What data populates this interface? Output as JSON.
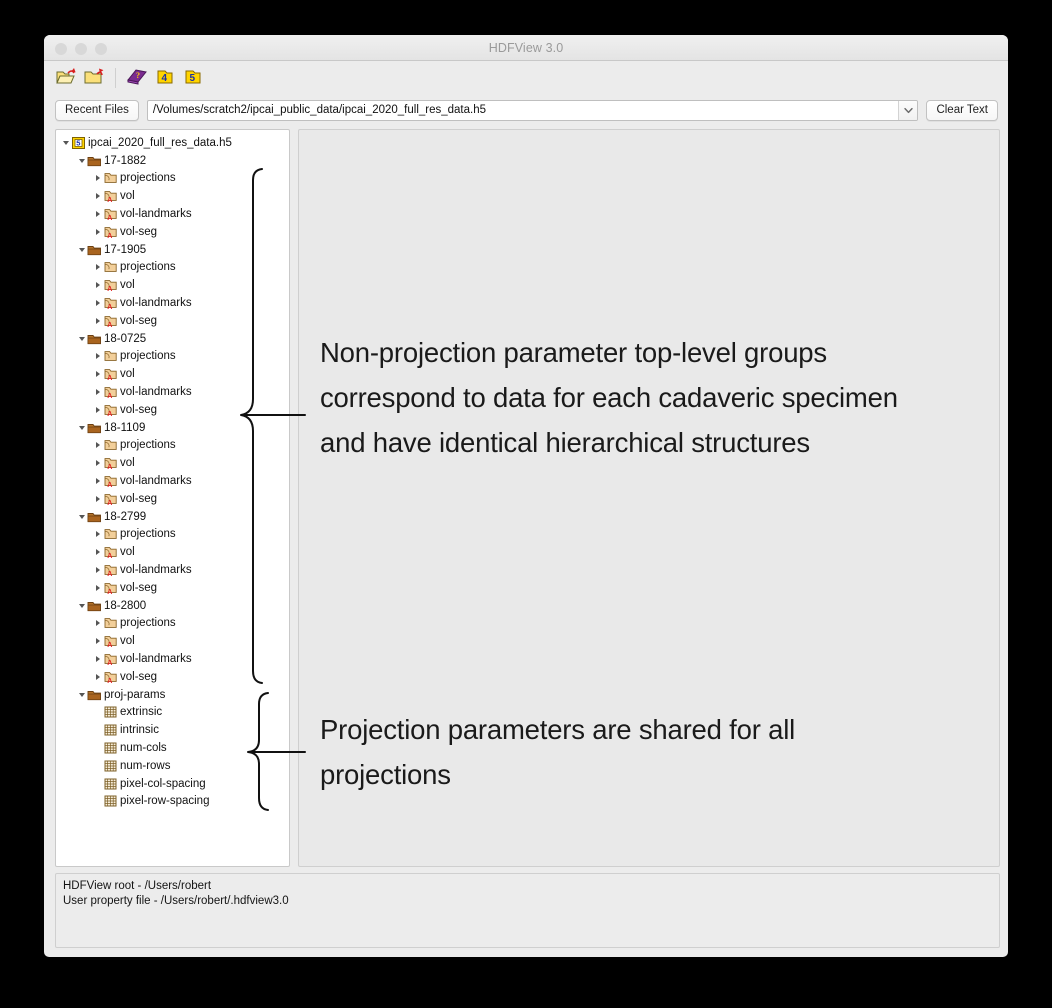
{
  "window": {
    "title": "HDFView 3.0",
    "traffic_lights": [
      "close",
      "minimize",
      "maximize"
    ]
  },
  "toolbar": {
    "buttons": [
      {
        "name": "open-file-icon",
        "tooltip": "Open"
      },
      {
        "name": "close-file-icon",
        "tooltip": "Close"
      },
      {
        "name": "help-book-icon",
        "tooltip": "Help"
      },
      {
        "name": "hdf4-icon",
        "tooltip": "HDF4 Library Version",
        "label": "4"
      },
      {
        "name": "hdf5-icon",
        "tooltip": "HDF5 Library Version",
        "label": "5"
      }
    ]
  },
  "pathbar": {
    "recent_files_label": "Recent Files",
    "path_value": "/Volumes/scratch2/ipcai_public_data/ipcai_2020_full_res_data.h5",
    "clear_text_label": "Clear Text"
  },
  "tree": {
    "rows": [
      {
        "depth": 0,
        "state": "open",
        "icon": "h5-file-icon",
        "label": "ipcai_2020_full_res_data.h5"
      },
      {
        "depth": 1,
        "state": "open",
        "icon": "group-icon",
        "label": "17-1882"
      },
      {
        "depth": 2,
        "state": "collapsed",
        "icon": "subgroup-icon",
        "label": "projections"
      },
      {
        "depth": 2,
        "state": "collapsed",
        "icon": "attr-group-icon",
        "label": "vol"
      },
      {
        "depth": 2,
        "state": "collapsed",
        "icon": "attr-group-icon",
        "label": "vol-landmarks"
      },
      {
        "depth": 2,
        "state": "collapsed",
        "icon": "attr-group-icon",
        "label": "vol-seg"
      },
      {
        "depth": 1,
        "state": "open",
        "icon": "group-icon",
        "label": "17-1905"
      },
      {
        "depth": 2,
        "state": "collapsed",
        "icon": "subgroup-icon",
        "label": "projections"
      },
      {
        "depth": 2,
        "state": "collapsed",
        "icon": "attr-group-icon",
        "label": "vol"
      },
      {
        "depth": 2,
        "state": "collapsed",
        "icon": "attr-group-icon",
        "label": "vol-landmarks"
      },
      {
        "depth": 2,
        "state": "collapsed",
        "icon": "attr-group-icon",
        "label": "vol-seg"
      },
      {
        "depth": 1,
        "state": "open",
        "icon": "group-icon",
        "label": "18-0725"
      },
      {
        "depth": 2,
        "state": "collapsed",
        "icon": "subgroup-icon",
        "label": "projections"
      },
      {
        "depth": 2,
        "state": "collapsed",
        "icon": "attr-group-icon",
        "label": "vol"
      },
      {
        "depth": 2,
        "state": "collapsed",
        "icon": "attr-group-icon",
        "label": "vol-landmarks"
      },
      {
        "depth": 2,
        "state": "collapsed",
        "icon": "attr-group-icon",
        "label": "vol-seg"
      },
      {
        "depth": 1,
        "state": "open",
        "icon": "group-icon",
        "label": "18-1109"
      },
      {
        "depth": 2,
        "state": "collapsed",
        "icon": "subgroup-icon",
        "label": "projections"
      },
      {
        "depth": 2,
        "state": "collapsed",
        "icon": "attr-group-icon",
        "label": "vol"
      },
      {
        "depth": 2,
        "state": "collapsed",
        "icon": "attr-group-icon",
        "label": "vol-landmarks"
      },
      {
        "depth": 2,
        "state": "collapsed",
        "icon": "attr-group-icon",
        "label": "vol-seg"
      },
      {
        "depth": 1,
        "state": "open",
        "icon": "group-icon",
        "label": "18-2799"
      },
      {
        "depth": 2,
        "state": "collapsed",
        "icon": "subgroup-icon",
        "label": "projections"
      },
      {
        "depth": 2,
        "state": "collapsed",
        "icon": "attr-group-icon",
        "label": "vol"
      },
      {
        "depth": 2,
        "state": "collapsed",
        "icon": "attr-group-icon",
        "label": "vol-landmarks"
      },
      {
        "depth": 2,
        "state": "collapsed",
        "icon": "attr-group-icon",
        "label": "vol-seg"
      },
      {
        "depth": 1,
        "state": "open",
        "icon": "group-icon",
        "label": "18-2800"
      },
      {
        "depth": 2,
        "state": "collapsed",
        "icon": "subgroup-icon",
        "label": "projections"
      },
      {
        "depth": 2,
        "state": "collapsed",
        "icon": "attr-group-icon",
        "label": "vol"
      },
      {
        "depth": 2,
        "state": "collapsed",
        "icon": "attr-group-icon",
        "label": "vol-landmarks"
      },
      {
        "depth": 2,
        "state": "collapsed",
        "icon": "attr-group-icon",
        "label": "vol-seg"
      },
      {
        "depth": 1,
        "state": "open",
        "icon": "group-icon",
        "label": "proj-params"
      },
      {
        "depth": 2,
        "state": "leaf",
        "icon": "dataset-icon",
        "label": "extrinsic"
      },
      {
        "depth": 2,
        "state": "leaf",
        "icon": "dataset-icon",
        "label": "intrinsic"
      },
      {
        "depth": 2,
        "state": "leaf",
        "icon": "dataset-icon",
        "label": "num-cols"
      },
      {
        "depth": 2,
        "state": "leaf",
        "icon": "dataset-icon",
        "label": "num-rows"
      },
      {
        "depth": 2,
        "state": "leaf",
        "icon": "dataset-icon",
        "label": "pixel-col-spacing"
      },
      {
        "depth": 2,
        "state": "leaf",
        "icon": "dataset-icon",
        "label": "pixel-row-spacing"
      }
    ]
  },
  "annotations": [
    {
      "id": "anno-1",
      "text": "Non-projection parameter top-level groups correspond to data for each cadaveric specimen and have identical hierarchical structures"
    },
    {
      "id": "anno-2",
      "text": "Projection parameters are shared for all projections"
    }
  ],
  "statusbar": {
    "line1": "HDFView root - /Users/robert",
    "line2": "User property file - /Users/robert/.hdfview3.0"
  },
  "colors": {
    "window_bg": "#ececec",
    "tree_bg": "#ffffff",
    "content_bg": "#e9e9e9",
    "title_text": "#9a9a9a",
    "folder_group": "#b5732a",
    "folder_sub": "#f2cf9a",
    "attr_red": "#e02020",
    "hdf_yellow": "#ffd400",
    "hdf_blue": "#1a2fa8",
    "book_purple": "#7a2b8f"
  }
}
